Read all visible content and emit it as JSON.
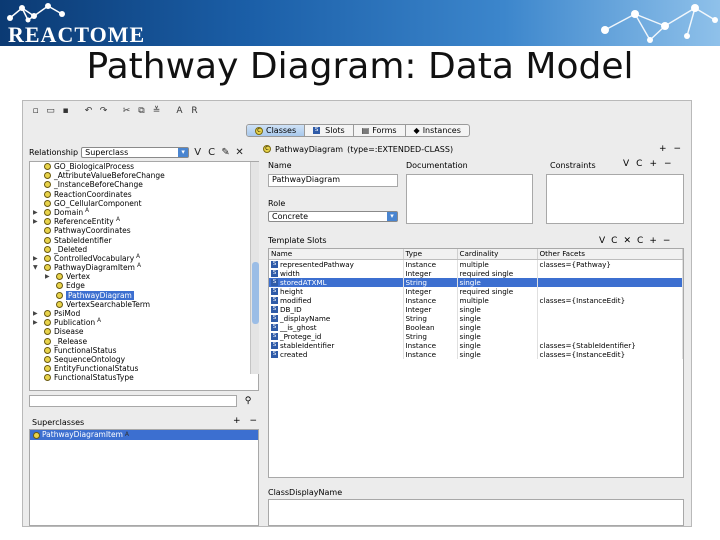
{
  "banner": {
    "logo_text": "REACTOME"
  },
  "slide_title": "Pathway Diagram: Data Model",
  "toolbar": {
    "icons": [
      "new-icon",
      "open-icon",
      "save-icon",
      "undo-icon",
      "redo-icon",
      "cut-icon",
      "copy-icon",
      "paste-icon",
      "a-icon",
      "r-icon"
    ],
    "letters": [
      "A",
      "R"
    ]
  },
  "main_tabs": [
    {
      "label": "Classes",
      "active": true
    },
    {
      "label": "Slots",
      "active": false
    },
    {
      "label": "Forms",
      "active": false
    },
    {
      "label": "Instances",
      "active": false
    }
  ],
  "left": {
    "relationship_label": "Relationship",
    "relationship_value": "Superclass",
    "tree": [
      {
        "label": "GO_BiologicalProcess",
        "indent": 0,
        "toggle": ""
      },
      {
        "label": "_AttributeValueBeforeChange",
        "indent": 0,
        "toggle": ""
      },
      {
        "label": "_InstanceBeforeChange",
        "indent": 0,
        "toggle": ""
      },
      {
        "label": "ReactionCoordinates",
        "indent": 0,
        "toggle": ""
      },
      {
        "label": "GO_CellularComponent",
        "indent": 0,
        "toggle": ""
      },
      {
        "label": "Domain",
        "indent": 0,
        "toggle": "▶",
        "sup": "A"
      },
      {
        "label": "ReferenceEntity",
        "indent": 0,
        "toggle": "▶",
        "sup": "A"
      },
      {
        "label": "PathwayCoordinates",
        "indent": 0,
        "toggle": ""
      },
      {
        "label": "StableIdentifier",
        "indent": 0,
        "toggle": ""
      },
      {
        "label": "_Deleted",
        "indent": 0,
        "toggle": ""
      },
      {
        "label": "ControlledVocabulary",
        "indent": 0,
        "toggle": "▶",
        "sup": "A"
      },
      {
        "label": "PathwayDiagramItem",
        "indent": 0,
        "toggle": "▼",
        "sup": "A"
      },
      {
        "label": "Vertex",
        "indent": 1,
        "toggle": "▶"
      },
      {
        "label": "Edge",
        "indent": 1,
        "toggle": ""
      },
      {
        "label": "PathwayDiagram",
        "indent": 1,
        "toggle": "",
        "selected": true
      },
      {
        "label": "VertexSearchableTerm",
        "indent": 1,
        "toggle": ""
      },
      {
        "label": "PsiMod",
        "indent": 0,
        "toggle": "▶"
      },
      {
        "label": "Publication",
        "indent": 0,
        "toggle": "▶",
        "sup": "A"
      },
      {
        "label": "Disease",
        "indent": 0,
        "toggle": ""
      },
      {
        "label": "_Release",
        "indent": 0,
        "toggle": ""
      },
      {
        "label": "FunctionalStatus",
        "indent": 0,
        "toggle": ""
      },
      {
        "label": "SequenceOntology",
        "indent": 0,
        "toggle": ""
      },
      {
        "label": "EntityFunctionalStatus",
        "indent": 0,
        "toggle": ""
      },
      {
        "label": "FunctionalStatusType",
        "indent": 0,
        "toggle": ""
      }
    ],
    "superclasses_label": "Superclasses",
    "superclass_item": "PathwayDiagramItem",
    "superclass_sup": "A"
  },
  "right": {
    "class_name": "PathwayDiagram",
    "class_type": "(type=:EXTENDED-CLASS)",
    "name_label": "Name",
    "name_value": "PathwayDiagram",
    "documentation_label": "Documentation",
    "constraints_label": "Constraints",
    "role_label": "Role",
    "role_value": "Concrete",
    "template_slots_label": "Template Slots",
    "columns": [
      "Name",
      "Type",
      "Cardinality",
      "Other Facets"
    ],
    "slots": [
      {
        "name": "representedPathway",
        "type": "Instance",
        "card": "multiple",
        "facets": "classes={Pathway}"
      },
      {
        "name": "width",
        "type": "Integer",
        "card": "required single",
        "facets": ""
      },
      {
        "name": "storedATXML",
        "type": "String",
        "card": "single",
        "facets": "",
        "selected": true
      },
      {
        "name": "height",
        "type": "Integer",
        "card": "required single",
        "facets": ""
      },
      {
        "name": "modified",
        "type": "Instance",
        "card": "multiple",
        "facets": "classes={InstanceEdit}"
      },
      {
        "name": "DB_ID",
        "type": "Integer",
        "card": "single",
        "facets": ""
      },
      {
        "name": "_displayName",
        "type": "String",
        "card": "single",
        "facets": ""
      },
      {
        "name": "__is_ghost",
        "type": "Boolean",
        "card": "single",
        "facets": ""
      },
      {
        "name": "_Protege_id",
        "type": "String",
        "card": "single",
        "facets": ""
      },
      {
        "name": "stableIdentifier",
        "type": "Instance",
        "card": "single",
        "facets": "classes={StableIdentifier}"
      },
      {
        "name": "created",
        "type": "Instance",
        "card": "single",
        "facets": "classes={InstanceEdit}"
      }
    ],
    "class_display_name_label": "ClassDisplayName"
  }
}
